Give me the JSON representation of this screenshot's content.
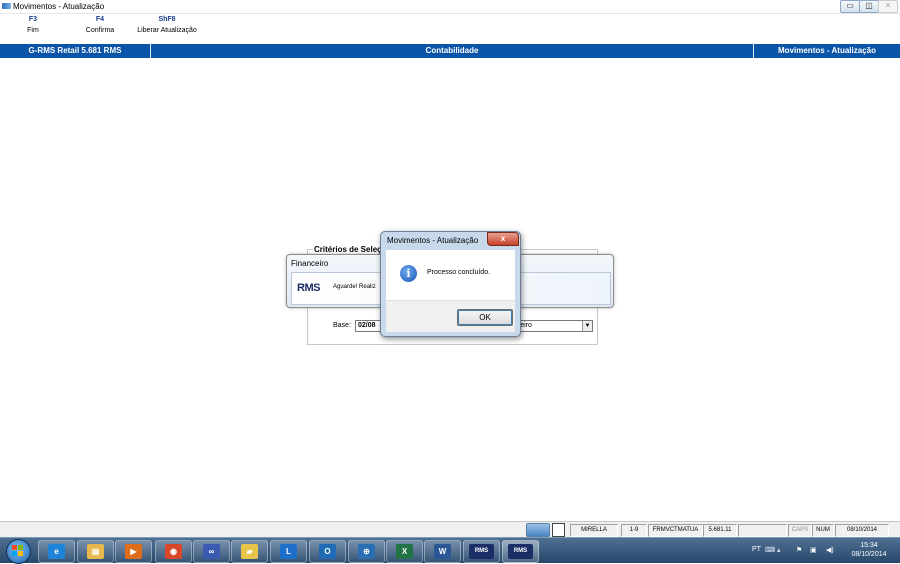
{
  "window": {
    "title": "Movimentos - Atualização",
    "buttons": {
      "minimize": "▭",
      "maximize": "◫",
      "close": "✕"
    }
  },
  "toolbar": {
    "keys": [
      {
        "key": "F3",
        "label": "Fim"
      },
      {
        "key": "F4",
        "label": "Confirma"
      },
      {
        "key": "ShF8",
        "label": "Liberar Atualização"
      }
    ]
  },
  "header": {
    "left": "G-RMS Retail 5.681 RMS",
    "center": "Contabilidade",
    "right": "Movimentos - Atualização"
  },
  "criteria": {
    "legend": "Critérios de Seleção",
    "base_label": "Base:",
    "base_value": "02/08",
    "combo_value": "ereiro"
  },
  "progress_window": {
    "title": "Financeiro",
    "logo": "RMS",
    "message": "Aguarde! Realiz"
  },
  "dialog": {
    "title": "Movimentos - Atualização",
    "message": "Processo concluído.",
    "ok_label": "OK",
    "close_label": "x"
  },
  "statusbar": {
    "user": "MIRELLA",
    "code": "1-9",
    "form": "FRMVCTMATUA",
    "version": "5.681.11",
    "caps": "CAPS",
    "num": "NUM",
    "date": "08/10/2014"
  },
  "taskbar": {
    "apps": [
      {
        "name": "ie",
        "glyph": "e",
        "color": "#1f84d8"
      },
      {
        "name": "explorer",
        "glyph": "▤",
        "color": "#e9b84c"
      },
      {
        "name": "media",
        "glyph": "▶",
        "color": "#e06d1a"
      },
      {
        "name": "chrome",
        "glyph": "◉",
        "color": "#d9472b"
      },
      {
        "name": "app-link",
        "glyph": "∞",
        "color": "#3a5bb0"
      },
      {
        "name": "folder",
        "glyph": "▰",
        "color": "#e8c44a"
      },
      {
        "name": "lync",
        "glyph": "L",
        "color": "#1d6fc9"
      },
      {
        "name": "outlook",
        "glyph": "O",
        "color": "#1f6bb5"
      },
      {
        "name": "network",
        "glyph": "⊕",
        "color": "#2a6fb4"
      },
      {
        "name": "excel",
        "glyph": "X",
        "color": "#217346"
      },
      {
        "name": "word",
        "glyph": "W",
        "color": "#2b5797"
      },
      {
        "name": "rms-1",
        "glyph": "RMS",
        "color": "#1b2f66"
      },
      {
        "name": "rms-2",
        "glyph": "RMS",
        "color": "#1b2f66"
      }
    ],
    "language": "PT",
    "time": "15:34",
    "date": "08/10/2014"
  },
  "colors": {
    "header_blue": "#0a55a8",
    "taskbar": "#27486b"
  }
}
